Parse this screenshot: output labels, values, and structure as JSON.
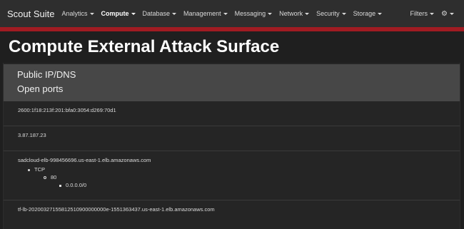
{
  "navbar": {
    "brand": "Scout Suite",
    "items": [
      {
        "label": "Analytics",
        "active": false
      },
      {
        "label": "Compute",
        "active": true
      },
      {
        "label": "Database",
        "active": false
      },
      {
        "label": "Management",
        "active": false
      },
      {
        "label": "Messaging",
        "active": false
      },
      {
        "label": "Network",
        "active": false
      },
      {
        "label": "Security",
        "active": false
      },
      {
        "label": "Storage",
        "active": false
      }
    ],
    "filters_label": "Filters",
    "settings_icon": "gear-icon"
  },
  "page": {
    "title": "Compute External Attack Surface"
  },
  "panel": {
    "header_line1": "Public IP/DNS",
    "header_line2": "Open ports",
    "entries": [
      {
        "host": "2600:1f18:213f:201:bfa0:3054:d269:70d1"
      },
      {
        "host": "3.87.187.23"
      },
      {
        "host": "sadcloud-elb-998456696.us-east-1.elb.amazonaws.com",
        "protocol": "TCP",
        "port": "80",
        "cidr": "0.0.0.0/0"
      },
      {
        "host": "tf-lb-20200327155812510900000000e-1551363437.us-east-1.elb.amazonaws.com"
      }
    ]
  },
  "colors": {
    "navbar_bg": "#2e2e2e",
    "accent": "#a01b22",
    "background": "#1f1f1f",
    "panel_header_bg": "#474747"
  }
}
